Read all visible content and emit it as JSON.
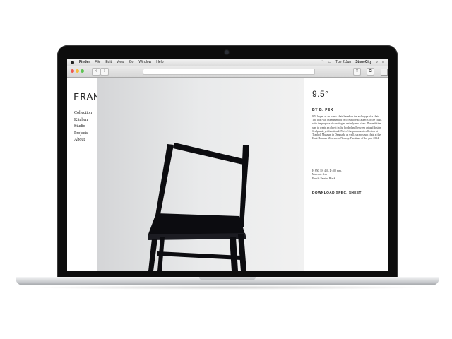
{
  "menubar": {
    "items": [
      "Finder",
      "File",
      "Edit",
      "View",
      "Go",
      "Window",
      "Help"
    ],
    "clock": "Tue 2 Jun",
    "user": "StrawCity"
  },
  "site": {
    "logo": "FRAMA",
    "nav": [
      "Collection",
      "Kitchen",
      "Studio",
      "Projects",
      "About"
    ]
  },
  "product": {
    "title": "9.5°",
    "author": "BY B. FEX",
    "description": "9.5° began as an iconic chair based on the archetype of a chair. The icon was experimented on to explore all aspects of the chair, with the purpose of creating an entirely new chair. The ambition was to create an object in the borderland between art and design. Sculptural, yet functional. Part of the permanent collection at Trapholt Museum in Denmark, as well as a museum chair at the Knut Hamsun Museum in Norway. Furniture of the year 2014.",
    "dimensions": "H 850, SH 450, D 400 mm.",
    "material": "Material: Ash",
    "finish": "Finish: Painted Black",
    "download": "DOWNLOAD SPEC. SHEET"
  },
  "colors": {
    "bezel": "#0d0d0d",
    "chair": "#0c0c10",
    "photo_bg": "#e6e7e8"
  }
}
